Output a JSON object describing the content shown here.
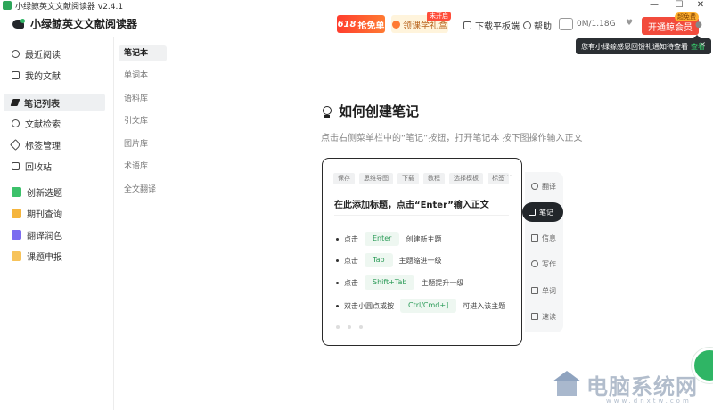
{
  "window": {
    "title": "小绿鲸英文文献阅读器 v2.4.1",
    "controls": [
      "—",
      "☐",
      "✕"
    ]
  },
  "appbar": {
    "brand": "小绿鲸英文文献阅读器",
    "promo_618_number": "618",
    "promo_618_text": "抢免单",
    "gift_label": "领课学礼盒",
    "gift_badge": "未开启",
    "download_pad": "下载平板端",
    "help": "帮助",
    "storage": "0M/1.18G",
    "vip_button": "开通鲸会员",
    "vip_badge": "超免费"
  },
  "notification": {
    "text": "您有小绿鲸感恩回馈礼通知待查看",
    "link": "查看",
    "close": "✕"
  },
  "sidebar": {
    "items": [
      {
        "label": "最近阅读",
        "icon": "clock-icon"
      },
      {
        "label": "我的文献",
        "icon": "document-icon"
      },
      {
        "label": "笔记列表",
        "icon": "pen-icon",
        "active": true
      },
      {
        "label": "文献检索",
        "icon": "search-icon"
      },
      {
        "label": "标签管理",
        "icon": "tag-icon"
      },
      {
        "label": "回收站",
        "icon": "trash-icon"
      },
      {
        "label": "创新选题",
        "icon": "idea-icon"
      },
      {
        "label": "期刊查询",
        "icon": "journal-icon"
      },
      {
        "label": "翻译润色",
        "icon": "translate-icon"
      },
      {
        "label": "课题申报",
        "icon": "project-icon"
      }
    ]
  },
  "nav2": {
    "items": [
      "笔记本",
      "单词本",
      "语料库",
      "引文库",
      "图片库",
      "术语库",
      "全文翻译"
    ]
  },
  "main": {
    "heading": "如何创建笔记",
    "subtitle": "点击右侧菜单栏中的“笔记”按钮，打开笔记本 按下图操作输入正文"
  },
  "card": {
    "chips": [
      "保存",
      "思维导图",
      "下载",
      "教程",
      "选择模板",
      "标签"
    ],
    "more": "···",
    "title": "在此添加标题，点击“Enter”输入正文",
    "rows": [
      {
        "pre": "点击",
        "key": "Enter",
        "post": "创建新主题"
      },
      {
        "pre": "点击",
        "key": "Tab",
        "post": "主题缩进一级"
      },
      {
        "pre": "点击",
        "key": "Shift+Tab",
        "post": "主题提升一级"
      },
      {
        "pre": "双击小圆点或按",
        "key": "Ctrl/Cmd+]",
        "post": "可进入该主题"
      }
    ]
  },
  "right_toolbar": {
    "items": [
      {
        "label": "翻译",
        "icon": "translate-icon"
      },
      {
        "label": "笔记",
        "icon": "note-icon",
        "active": true
      },
      {
        "label": "信息",
        "icon": "info-icon"
      },
      {
        "label": "写作",
        "icon": "write-icon"
      },
      {
        "label": "单词",
        "icon": "word-icon"
      },
      {
        "label": "速读",
        "icon": "speed-read-icon"
      }
    ]
  },
  "watermark": {
    "text": "电脑系统网",
    "url": "www.dnxtw.com"
  },
  "colors": {
    "accent_green": "#2fb565",
    "vip_red": "#f24b3c",
    "promo_orange": "#ff7a32"
  }
}
